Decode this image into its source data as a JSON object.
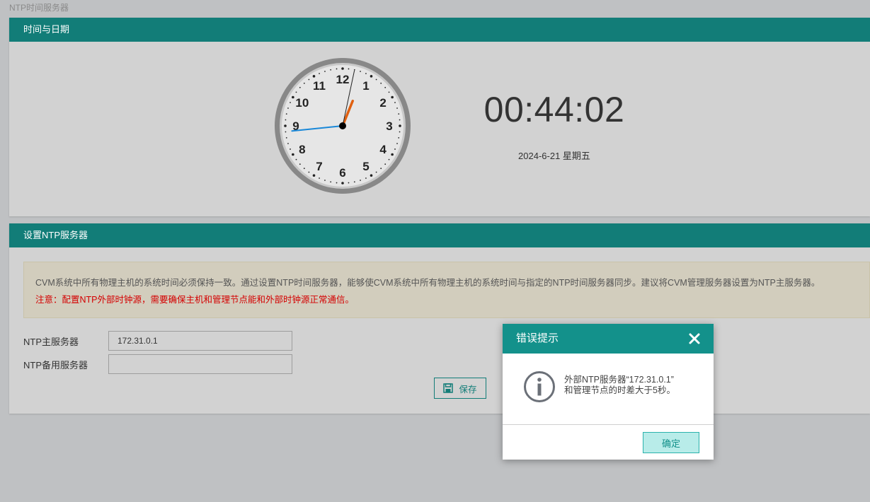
{
  "breadcrumb": "NTP时间服务器",
  "time_panel": {
    "title": "时间与日期",
    "digital_time": "00:44:02",
    "date": "2024-6-21 星期五",
    "clock_numbers": [
      "12",
      "1",
      "2",
      "3",
      "4",
      "5",
      "6",
      "7",
      "8",
      "9",
      "10",
      "11"
    ],
    "clock": {
      "hour": 0,
      "minute": 44,
      "second": 2
    },
    "colors": {
      "hour_hand": "#e06010",
      "minute_hand": "#1a88d8",
      "second_hand": "#222222"
    }
  },
  "ntp_panel": {
    "title": "设置NTP服务器",
    "notice_text": "CVM系统中所有物理主机的系统时间必须保持一致。通过设置NTP时间服务器，能够使CVM系统中所有物理主机的系统时间与指定的NTP时间服务器同步。建议将CVM管理服务器设置为NTP主服务器。",
    "warning_text": "注意：配置NTP外部时钟源，需要确保主机和管理节点能和外部时钟源正常通信。",
    "primary_label": "NTP主服务器",
    "primary_value": "172.31.0.1",
    "backup_label": "NTP备用服务器",
    "backup_value": "",
    "save_label": "保存",
    "save_icon": "floppy-disk-icon"
  },
  "dialog": {
    "title": "错误提示",
    "message_line1": "外部NTP服务器“172.31.0.1”",
    "message_line2": "和管理节点的时差大于5秒。",
    "confirm_label": "确定",
    "icon": "info-icon",
    "close_icon": "close-icon"
  },
  "colors": {
    "header_teal": "#127d78",
    "dialog_teal": "#13918b",
    "page_bg": "#bfc1c3",
    "panel_bg": "#d2d2d2",
    "warning_red": "#d40000"
  }
}
